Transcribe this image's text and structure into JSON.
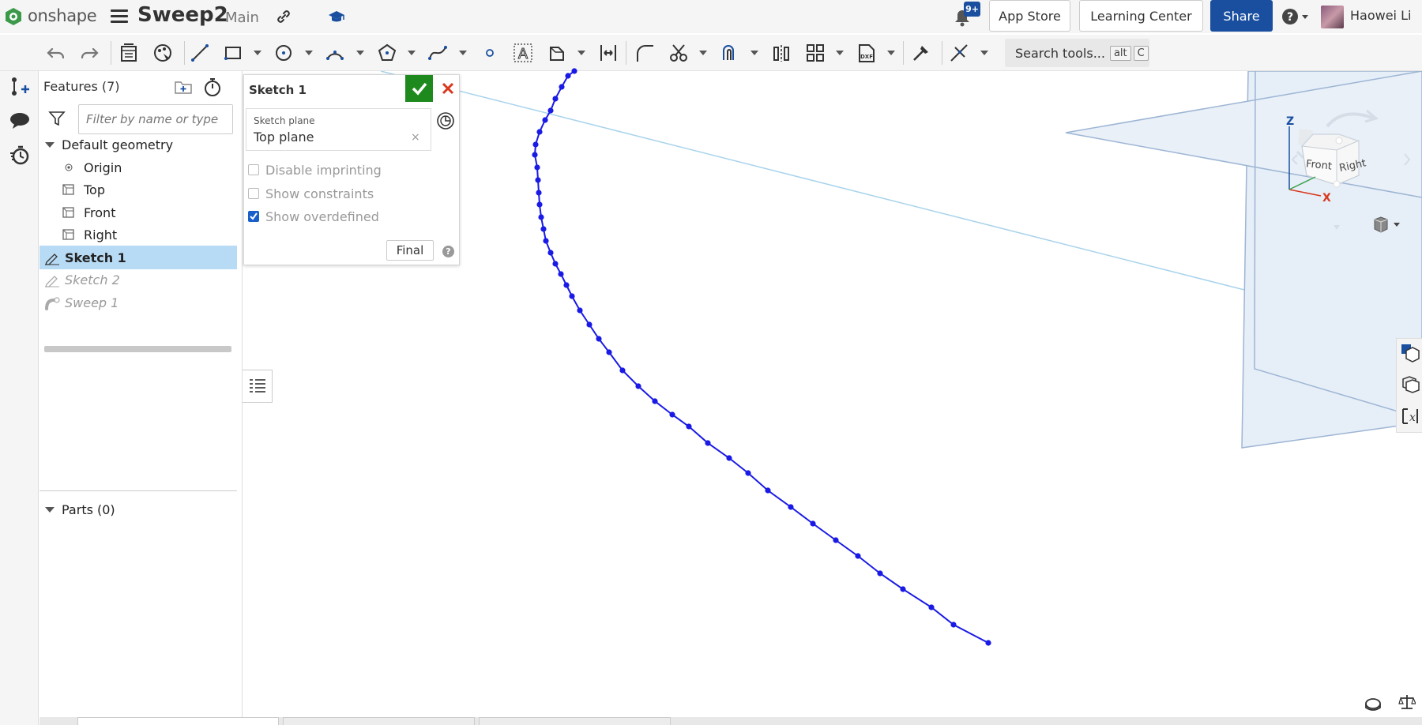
{
  "app": {
    "logo_text": "onshape",
    "doc_title": "Sweep2",
    "branch": "Main"
  },
  "header": {
    "notification_badge": "9+",
    "app_store_label": "App Store",
    "learning_center_label": "Learning Center",
    "share_label": "Share",
    "user_name": "Haowei Li"
  },
  "toolbar": {
    "search_label": "Search tools...",
    "search_key1": "alt",
    "search_key2": "C"
  },
  "feature_panel": {
    "title": "Features (7)",
    "filter_placeholder": "Filter by name or type",
    "default_geometry": "Default geometry",
    "items": [
      {
        "label": "Origin"
      },
      {
        "label": "Top"
      },
      {
        "label": "Front"
      },
      {
        "label": "Right"
      },
      {
        "label": "Sketch 1"
      },
      {
        "label": "Sketch 2"
      },
      {
        "label": "Sweep 1"
      }
    ],
    "parts_label": "Parts (0)"
  },
  "sketch_dialog": {
    "title": "Sketch 1",
    "plane_caption": "Sketch plane",
    "plane_value": "Top plane",
    "disable_imprinting": "Disable imprinting",
    "show_constraints": "Show constraints",
    "show_overdefined": "Show overdefined",
    "show_overdefined_checked": true,
    "final_label": "Final"
  },
  "view_cube": {
    "front": "Front",
    "right": "Right",
    "axis_z": "Z",
    "axis_x": "X"
  },
  "colors": {
    "accent": "#1a4fa0",
    "ok_green": "#1e8a1e",
    "cancel_red": "#d9381e",
    "selected_row": "#b8dbf5",
    "sketch_curve": "#1a1ae6"
  }
}
